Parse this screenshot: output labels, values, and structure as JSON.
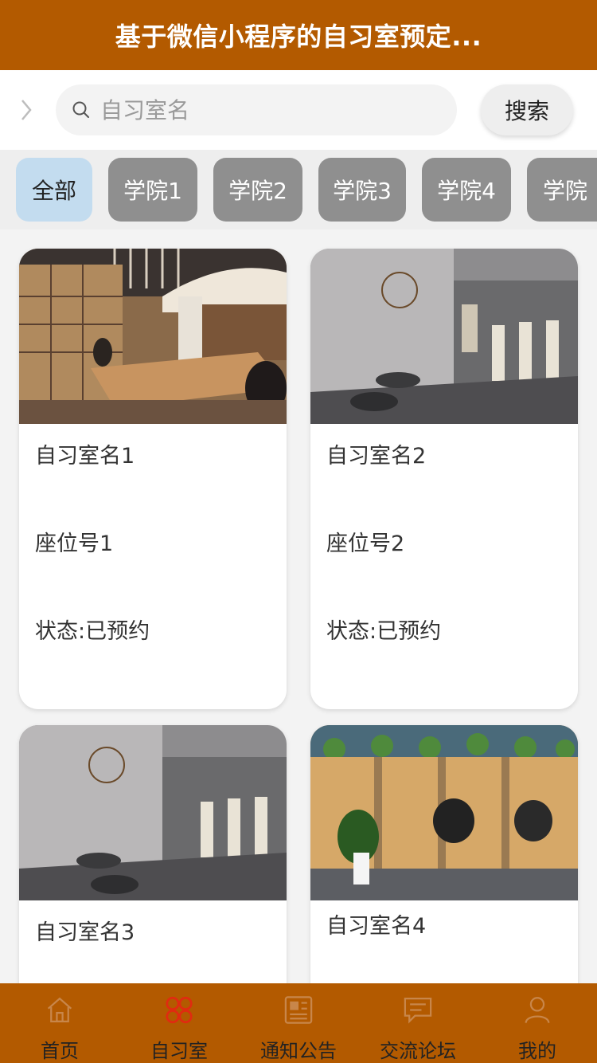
{
  "header": {
    "title": "基于微信小程序的自习室预定..."
  },
  "search": {
    "placeholder": "自习室名",
    "button_label": "搜索"
  },
  "categories": [
    {
      "label": "全部",
      "active": true
    },
    {
      "label": "学院1",
      "active": false
    },
    {
      "label": "学院2",
      "active": false
    },
    {
      "label": "学院3",
      "active": false
    },
    {
      "label": "学院4",
      "active": false
    },
    {
      "label": "学院",
      "active": false
    }
  ],
  "rooms": [
    {
      "name": "自习室名1",
      "seat": "座位号1",
      "status": "状态:已预约"
    },
    {
      "name": "自习室名2",
      "seat": "座位号2",
      "status": "状态:已预约"
    },
    {
      "name": "自习室名3"
    },
    {
      "name": "自习室名4"
    }
  ],
  "tabs": [
    {
      "label": "首页",
      "icon": "home-icon",
      "active": false
    },
    {
      "label": "自习室",
      "icon": "grid-icon",
      "active": true
    },
    {
      "label": "通知公告",
      "icon": "news-icon",
      "active": false
    },
    {
      "label": "交流论坛",
      "icon": "chat-icon",
      "active": false
    },
    {
      "label": "我的",
      "icon": "user-icon",
      "active": false
    }
  ],
  "colors": {
    "brand": "#b35a00",
    "active_tab_icon": "#e02b10",
    "inactive_tab_icon": "#c8864a",
    "chip_active": "#c3dcef",
    "chip_inactive": "#8f8f8f"
  }
}
